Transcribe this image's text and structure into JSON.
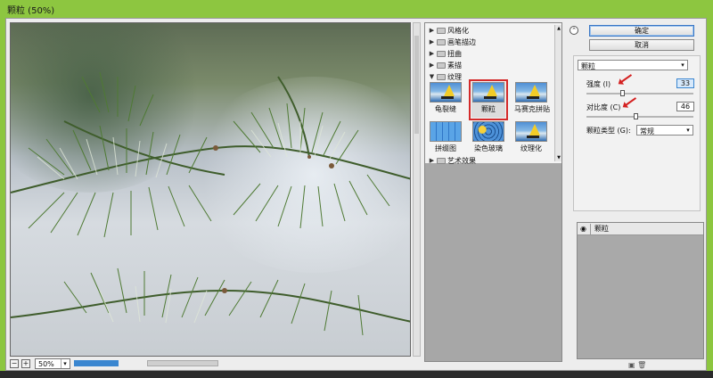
{
  "window": {
    "title": "颗粒 (50%)"
  },
  "preview": {
    "zoom_value": "50%",
    "zoom_out_symbol": "−",
    "zoom_in_symbol": "+"
  },
  "gallery": {
    "categories_top": [
      {
        "label": "风格化",
        "expanded": false
      },
      {
        "label": "画笔描边",
        "expanded": false
      },
      {
        "label": "扭曲",
        "expanded": false
      },
      {
        "label": "素描",
        "expanded": false
      }
    ],
    "open_category": {
      "label": "纹理",
      "expanded": true
    },
    "thumbnails": [
      {
        "label": "龟裂缝"
      },
      {
        "label": "颗粒",
        "selected": true
      },
      {
        "label": "马赛克拼贴"
      },
      {
        "label": "拼缀图"
      },
      {
        "label": "染色玻璃"
      },
      {
        "label": "纹理化"
      }
    ],
    "category_bottom": {
      "label": "艺术效果",
      "expanded": false
    }
  },
  "actions": {
    "ok_label": "确定",
    "cancel_label": "取消"
  },
  "settings": {
    "filter_selected": "颗粒",
    "intensity": {
      "label": "强度 (I)",
      "value": "33",
      "fraction": 0.33
    },
    "contrast": {
      "label": "对比度 (C)",
      "value": "46",
      "fraction": 0.46
    },
    "grain_type": {
      "label": "颗粒类型 (G):",
      "value": "常规"
    }
  },
  "layers": {
    "items": [
      {
        "name": "颗粒",
        "visible": true
      }
    ]
  },
  "status": {
    "text": ""
  },
  "colors": {
    "title_bar": "#8dc640",
    "annotation_red": "#d42a2a",
    "accent_blue": "#3a86d0"
  }
}
